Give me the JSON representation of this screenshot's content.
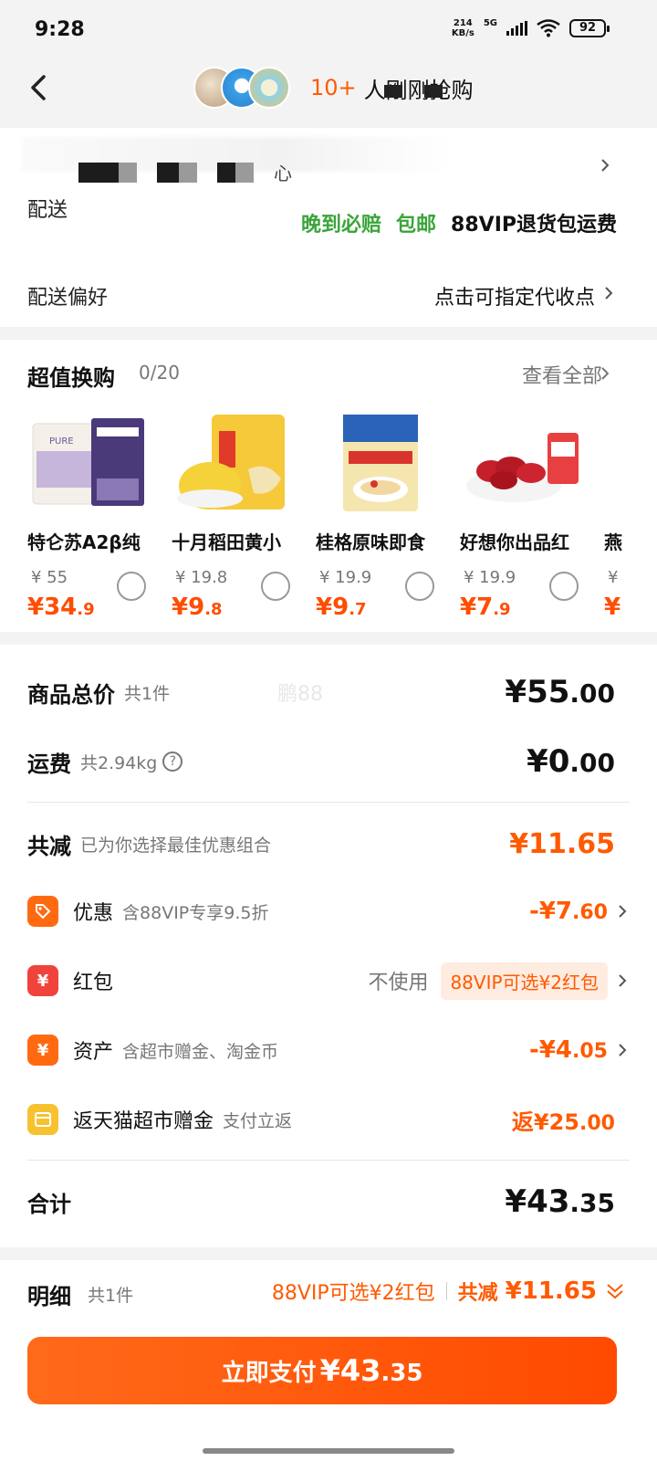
{
  "status": {
    "time": "9:28",
    "speed_top": "214",
    "speed_bottom": "KB/s",
    "network": "5G",
    "battery": "92"
  },
  "nav": {
    "count": "10+",
    "text": "人刚刚抢购"
  },
  "address": {
    "tail_text": "心"
  },
  "delivery": {
    "label": "配送",
    "tags": [
      "晚到必赔",
      "包邮",
      "88VIP退货包运费"
    ],
    "pref_label": "配送偏好",
    "pref_value": "点击可指定代收点"
  },
  "swap": {
    "title": "超值换购",
    "count": "0/20",
    "view_all": "查看全部",
    "products": [
      {
        "name": "特仑苏A2β纯",
        "orig": "¥ 55",
        "price_int": "¥34",
        "price_dec": ".9",
        "img": "milk-box-image"
      },
      {
        "name": "十月稻田黄小",
        "orig": "¥ 19.8",
        "price_int": "¥9",
        "price_dec": ".8",
        "img": "millet-bag-image"
      },
      {
        "name": "桂格原味即食",
        "orig": "¥ 19.9",
        "price_int": "¥9",
        "price_dec": ".7",
        "img": "oatmeal-bag-image"
      },
      {
        "name": "好想你出品红",
        "orig": "¥ 19.9",
        "price_int": "¥7",
        "price_dec": ".9",
        "img": "red-dates-image"
      },
      {
        "name": "燕",
        "orig": "¥",
        "price_int": "¥",
        "price_dec": "",
        "img": "partial-product-image"
      }
    ]
  },
  "summary": {
    "goods_label": "商品总价",
    "goods_sub": "共1件",
    "goods_amt_int": "¥55",
    "goods_amt_dec": ".00",
    "watermark": "鹏88",
    "freight_label": "运费",
    "freight_sub": "共2.94kg",
    "freight_amt_int": "¥0",
    "freight_amt_dec": ".00",
    "reduce_label": "共减",
    "reduce_sub": "已为你选择最佳优惠组合",
    "reduce_amt": "¥11.65",
    "discount_label": "优惠",
    "discount_sub": "含88VIP专享9.5折",
    "discount_amt_int": "-¥7",
    "discount_amt_dec": ".60",
    "redpacket_label": "红包",
    "redpacket_none": "不使用",
    "redpacket_badge": "88VIP可选¥2红包",
    "asset_label": "资产",
    "asset_sub": "含超市赠金、淘金币",
    "asset_amt_int": "-¥4",
    "asset_amt_dec": ".05",
    "cashback_label": "返天猫超市赠金",
    "cashback_sub": "支付立返",
    "cashback_amt_int": "返¥25",
    "cashback_amt_dec": ".00",
    "total_label": "合计",
    "total_amt_int": "¥43",
    "total_amt_dec": ".35"
  },
  "bottom": {
    "detail_label": "明细",
    "detail_count": "共1件",
    "redpacket_hint": "88VIP可选¥2红包",
    "reduce_label": "共减",
    "reduce_amt": "¥11.65",
    "pay_label": "立即支付",
    "pay_amt_int": "¥43",
    "pay_amt_dec": ".35"
  },
  "colors": {
    "accent": "#ff5a00",
    "green": "#3aa53a",
    "background": "#f3f3f3"
  },
  "icons": [
    "back-icon",
    "tag-icon",
    "red-envelope-icon",
    "yen-icon",
    "gift-card-icon",
    "help-icon",
    "chevron-right-icon",
    "double-chevron-down-icon"
  ]
}
